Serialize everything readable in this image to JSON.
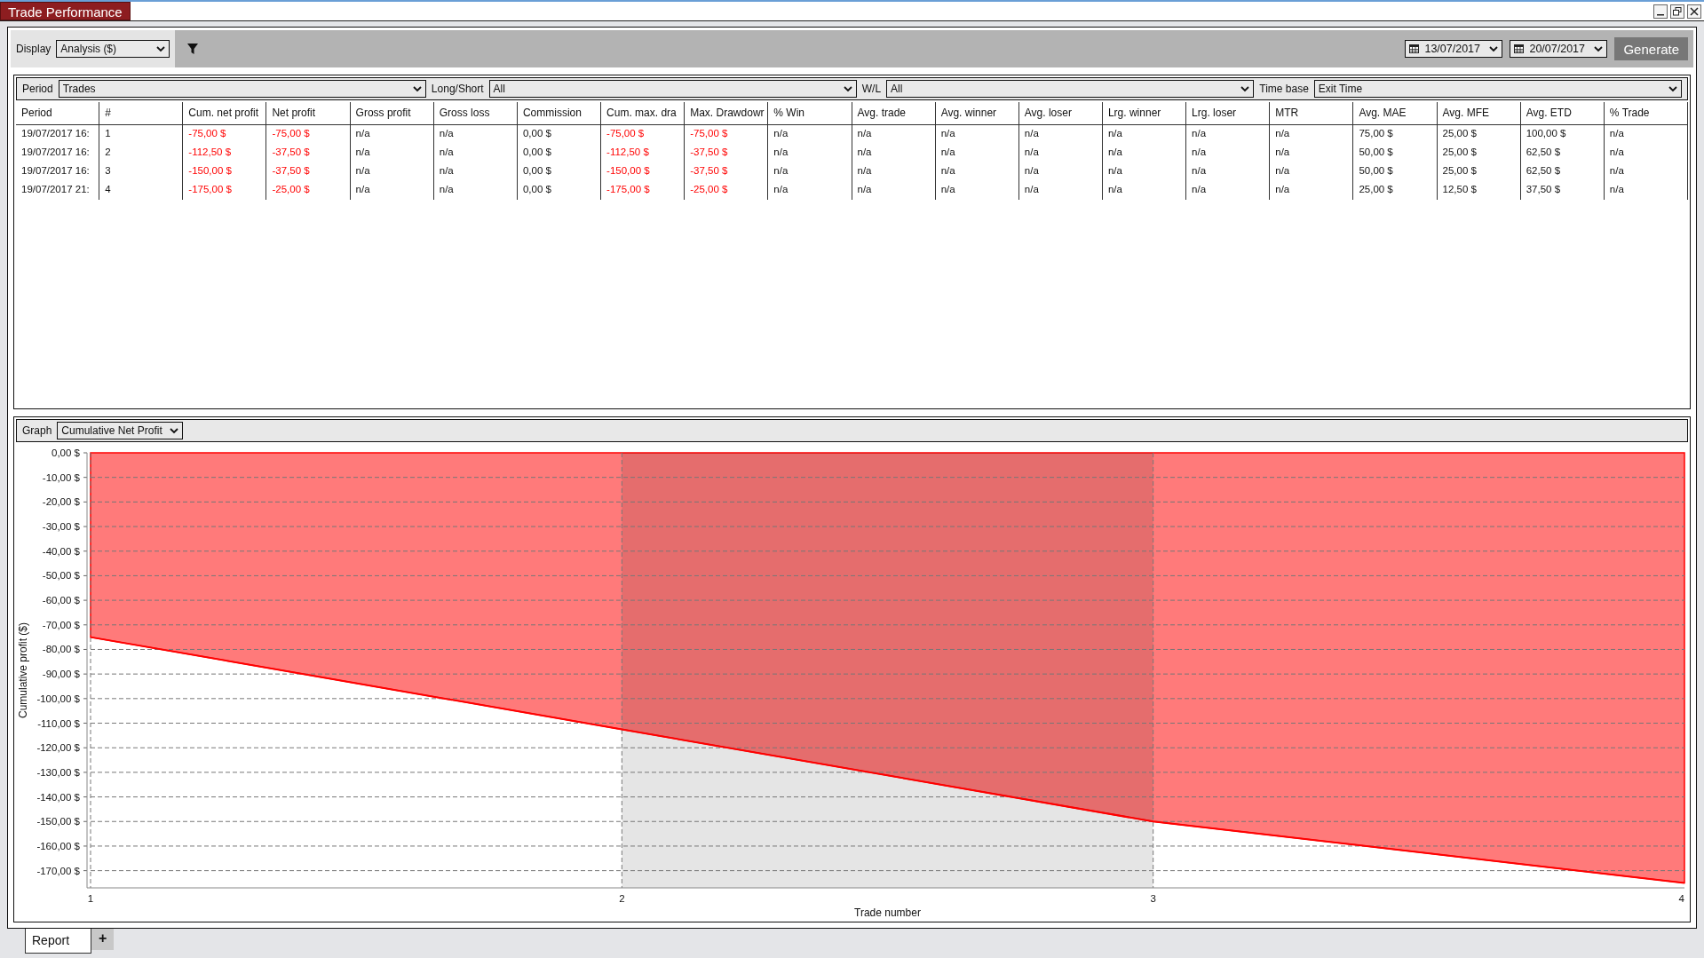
{
  "window": {
    "title": "Trade Performance"
  },
  "toolbar": {
    "display_label": "Display",
    "display_value": "Analysis ($)",
    "start_date": "13/07/2017",
    "end_date": "20/07/2017",
    "generate": "Generate"
  },
  "filters": [
    {
      "label": "Period",
      "value": "Trades"
    },
    {
      "label": "Long/Short",
      "value": "All"
    },
    {
      "label": "W/L",
      "value": "All"
    },
    {
      "label": "Time base",
      "value": "Exit Time"
    }
  ],
  "table": {
    "columns": [
      "Period",
      "#",
      "Cum. net profit",
      "Net profit",
      "Gross profit",
      "Gross loss",
      "Commission",
      "Cum. max. dra",
      "Max. Drawdowr",
      "% Win",
      "Avg. trade",
      "Avg. winner",
      "Avg. loser",
      "Lrg. winner",
      "Lrg. loser",
      "MTR",
      "Avg. MAE",
      "Avg. MFE",
      "Avg. ETD",
      "% Trade"
    ],
    "rows": [
      {
        "cells": [
          {
            "text": "19/07/2017 16:",
            "loss": false
          },
          {
            "text": "1",
            "loss": false
          },
          {
            "text": "-75,00 $",
            "loss": true
          },
          {
            "text": "-75,00 $",
            "loss": true
          },
          {
            "text": "n/a",
            "loss": false
          },
          {
            "text": "n/a",
            "loss": false
          },
          {
            "text": "0,00 $",
            "loss": false
          },
          {
            "text": "-75,00 $",
            "loss": true
          },
          {
            "text": "-75,00 $",
            "loss": true
          },
          {
            "text": "n/a",
            "loss": false
          },
          {
            "text": "n/a",
            "loss": false
          },
          {
            "text": "n/a",
            "loss": false
          },
          {
            "text": "n/a",
            "loss": false
          },
          {
            "text": "n/a",
            "loss": false
          },
          {
            "text": "n/a",
            "loss": false
          },
          {
            "text": "n/a",
            "loss": false
          },
          {
            "text": "75,00 $",
            "loss": false
          },
          {
            "text": "25,00 $",
            "loss": false
          },
          {
            "text": "100,00 $",
            "loss": false
          },
          {
            "text": "n/a",
            "loss": false
          }
        ]
      },
      {
        "cells": [
          {
            "text": "19/07/2017 16:",
            "loss": false
          },
          {
            "text": "2",
            "loss": false
          },
          {
            "text": "-112,50 $",
            "loss": true
          },
          {
            "text": "-37,50 $",
            "loss": true
          },
          {
            "text": "n/a",
            "loss": false
          },
          {
            "text": "n/a",
            "loss": false
          },
          {
            "text": "0,00 $",
            "loss": false
          },
          {
            "text": "-112,50 $",
            "loss": true
          },
          {
            "text": "-37,50 $",
            "loss": true
          },
          {
            "text": "n/a",
            "loss": false
          },
          {
            "text": "n/a",
            "loss": false
          },
          {
            "text": "n/a",
            "loss": false
          },
          {
            "text": "n/a",
            "loss": false
          },
          {
            "text": "n/a",
            "loss": false
          },
          {
            "text": "n/a",
            "loss": false
          },
          {
            "text": "n/a",
            "loss": false
          },
          {
            "text": "50,00 $",
            "loss": false
          },
          {
            "text": "25,00 $",
            "loss": false
          },
          {
            "text": "62,50 $",
            "loss": false
          },
          {
            "text": "n/a",
            "loss": false
          }
        ]
      },
      {
        "cells": [
          {
            "text": "19/07/2017 16:",
            "loss": false
          },
          {
            "text": "3",
            "loss": false
          },
          {
            "text": "-150,00 $",
            "loss": true
          },
          {
            "text": "-37,50 $",
            "loss": true
          },
          {
            "text": "n/a",
            "loss": false
          },
          {
            "text": "n/a",
            "loss": false
          },
          {
            "text": "0,00 $",
            "loss": false
          },
          {
            "text": "-150,00 $",
            "loss": true
          },
          {
            "text": "-37,50 $",
            "loss": true
          },
          {
            "text": "n/a",
            "loss": false
          },
          {
            "text": "n/a",
            "loss": false
          },
          {
            "text": "n/a",
            "loss": false
          },
          {
            "text": "n/a",
            "loss": false
          },
          {
            "text": "n/a",
            "loss": false
          },
          {
            "text": "n/a",
            "loss": false
          },
          {
            "text": "n/a",
            "loss": false
          },
          {
            "text": "50,00 $",
            "loss": false
          },
          {
            "text": "25,00 $",
            "loss": false
          },
          {
            "text": "62,50 $",
            "loss": false
          },
          {
            "text": "n/a",
            "loss": false
          }
        ]
      },
      {
        "cells": [
          {
            "text": "19/07/2017 21:",
            "loss": false
          },
          {
            "text": "4",
            "loss": false
          },
          {
            "text": "-175,00 $",
            "loss": true
          },
          {
            "text": "-25,00 $",
            "loss": true
          },
          {
            "text": "n/a",
            "loss": false
          },
          {
            "text": "n/a",
            "loss": false
          },
          {
            "text": "0,00 $",
            "loss": false
          },
          {
            "text": "-175,00 $",
            "loss": true
          },
          {
            "text": "-25,00 $",
            "loss": true
          },
          {
            "text": "n/a",
            "loss": false
          },
          {
            "text": "n/a",
            "loss": false
          },
          {
            "text": "n/a",
            "loss": false
          },
          {
            "text": "n/a",
            "loss": false
          },
          {
            "text": "n/a",
            "loss": false
          },
          {
            "text": "n/a",
            "loss": false
          },
          {
            "text": "n/a",
            "loss": false
          },
          {
            "text": "25,00 $",
            "loss": false
          },
          {
            "text": "12,50 $",
            "loss": false
          },
          {
            "text": "37,50 $",
            "loss": false
          },
          {
            "text": "n/a",
            "loss": false
          }
        ]
      }
    ]
  },
  "graph": {
    "label": "Graph",
    "value": "Cumulative Net Profit",
    "chart_data": {
      "type": "area",
      "xlabel": "Trade number",
      "ylabel": "Cumulative profit ($)",
      "x": [
        1,
        2,
        3,
        4
      ],
      "series": [
        {
          "color": "#ff0000",
          "values": [
            -75,
            -112.5,
            -150,
            -175
          ]
        }
      ],
      "grid": true,
      "xlim": [
        1,
        4
      ],
      "ylim": [
        -177,
        0
      ],
      "xticks": [
        1,
        2,
        3,
        4
      ],
      "yticks": [
        {
          "value": 0,
          "label": "0,00 $"
        },
        {
          "value": -10,
          "label": "-10,00 $"
        },
        {
          "value": -20,
          "label": "-20,00 $"
        },
        {
          "value": -30,
          "label": "-30,00 $"
        },
        {
          "value": -40,
          "label": "-40,00 $"
        },
        {
          "value": -50,
          "label": "-50,00 $"
        },
        {
          "value": -60,
          "label": "-60,00 $"
        },
        {
          "value": -70,
          "label": "-70,00 $"
        },
        {
          "value": -80,
          "label": "-80,00 $"
        },
        {
          "value": -90,
          "label": "-90,00 $"
        },
        {
          "value": -100,
          "label": "-100,00 $"
        },
        {
          "value": -110,
          "label": "-110,00 $"
        },
        {
          "value": -120,
          "label": "-120,00 $"
        },
        {
          "value": -130,
          "label": "-130,00 $"
        },
        {
          "value": -140,
          "label": "-140,00 $"
        },
        {
          "value": -150,
          "label": "-150,00 $"
        },
        {
          "value": -160,
          "label": "-160,00 $"
        },
        {
          "value": -170,
          "label": "-170,00 $"
        }
      ],
      "bands": [
        {
          "axis": "x",
          "from": 2,
          "to": 3
        }
      ]
    }
  },
  "tabs": [
    {
      "label": "Report",
      "selected": true
    }
  ],
  "add_tab": "+"
}
